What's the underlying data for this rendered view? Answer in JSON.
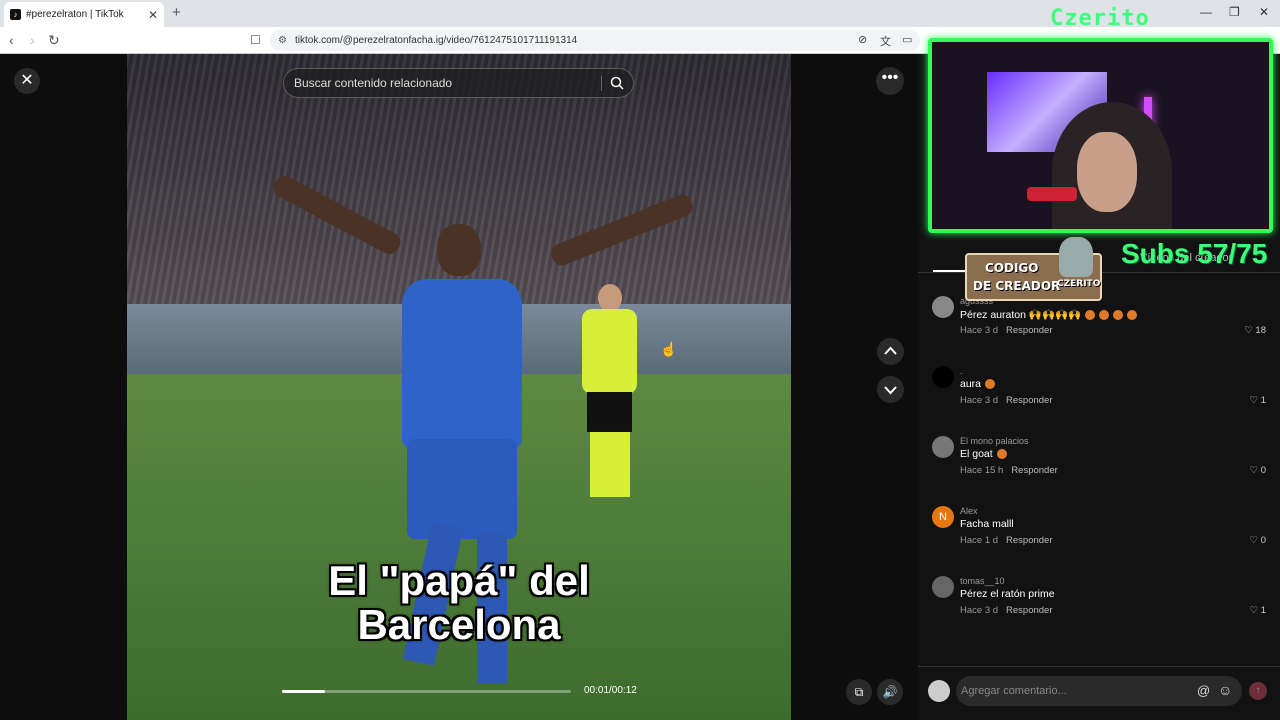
{
  "browser": {
    "tab_title": "#perezelraton | TikTok",
    "url": "tiktok.com/@perezelratonfacha.ig/video/7612475101711191314"
  },
  "video": {
    "search_placeholder": "Buscar contenido relacionado",
    "caption_line1": "El \"papá\" del",
    "caption_line2": "Barcelona",
    "time": "00:01/00:12",
    "progress": 0.15
  },
  "comments_panel": {
    "creator_tab_label": "Vídeos del creador",
    "input_placeholder": "Agregar comentario...",
    "comments": [
      {
        "user": "agussss",
        "text": "Pérez auraton 🙌🙌🙌🙌",
        "time": "Hace 3 d",
        "reply": "Responder",
        "likes": "18",
        "fire": 4
      },
      {
        "user": ".",
        "text": "aura",
        "time": "Hace 3 d",
        "reply": "Responder",
        "likes": "1",
        "fire": 1
      },
      {
        "user": "El mono palacios",
        "text": "El goat",
        "time": "Hace 15 h",
        "reply": "Responder",
        "likes": "0",
        "fire": 1
      },
      {
        "user": "Alex",
        "text": "Facha malll",
        "time": "Hace 1 d",
        "reply": "Responder",
        "likes": "0",
        "fire": 0
      },
      {
        "user": "tomas__10",
        "text": "Pérez el ratón prime",
        "time": "Hace 3 d",
        "reply": "Responder",
        "likes": "1",
        "fire": 0
      }
    ]
  },
  "overlay": {
    "name": "Czerito",
    "code_line1": "CODIGO",
    "code_line2": "DE CREADOR",
    "code_brand": "CZERITO",
    "subs": "Subs 57/75"
  },
  "colors": {
    "overlay_green": "#3dff7a",
    "accent_red": "#fe2c55"
  }
}
